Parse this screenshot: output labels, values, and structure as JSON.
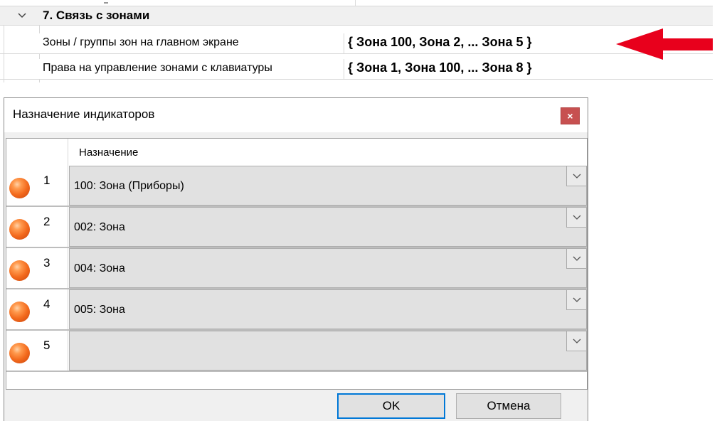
{
  "property_grid": {
    "category": {
      "title": "7. Связь с зонами",
      "expanded": true
    },
    "rows": [
      {
        "label": "Зоны / группы зон на главном экране",
        "value": "{ Зона 100, Зона 2, ... Зона 5 }"
      },
      {
        "label": "Права на управление зонами с клавиатуры",
        "value": "{ Зона 1, Зона 100, ... Зона 8 }"
      }
    ],
    "annotation": {
      "arrow_color": "#e8001c"
    }
  },
  "dialog": {
    "title": "Назначение индикаторов",
    "close_glyph": "×",
    "table": {
      "header": "Назначение",
      "rows": [
        {
          "index": "1",
          "value": "100: Зона (Приборы)"
        },
        {
          "index": "2",
          "value": "002: Зона"
        },
        {
          "index": "3",
          "value": "004: Зона"
        },
        {
          "index": "4",
          "value": "005: Зона"
        },
        {
          "index": "5",
          "value": ""
        }
      ]
    },
    "buttons": {
      "ok": "OK",
      "cancel": "Отмена"
    }
  },
  "colors": {
    "led": "#f36a1d",
    "close_button": "#c75050",
    "ok_border": "#0078d7"
  }
}
